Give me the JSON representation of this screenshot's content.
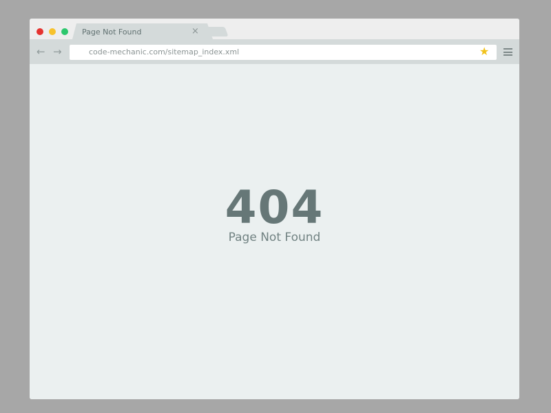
{
  "browser": {
    "tab": {
      "title": "Page Not Found",
      "close_glyph": "×"
    },
    "nav": {
      "back_glyph": "←",
      "forward_glyph": "→"
    },
    "address": {
      "url": "code-mechanic.com/sitemap_index.xml"
    },
    "bookmark_glyph": "★",
    "icons": [
      "close-dot-icon",
      "minimize-dot-icon",
      "maximize-dot-icon",
      "tab-close-icon",
      "back-arrow-icon",
      "forward-arrow-icon",
      "star-icon",
      "hamburger-menu-icon"
    ],
    "colors": {
      "close": "#e5322f",
      "minimize": "#f7c22c",
      "maximize": "#2dc76d",
      "star": "#f1c21b"
    }
  },
  "page": {
    "code": "404",
    "message": "Page Not Found"
  }
}
